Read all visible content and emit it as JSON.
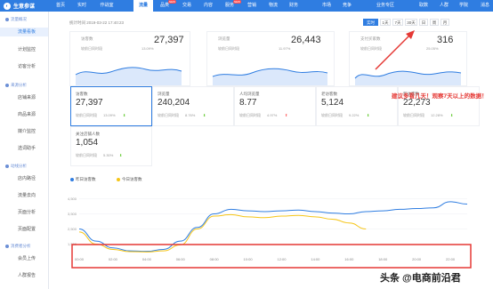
{
  "brand": {
    "name": "生意参谋"
  },
  "nav": {
    "items": [
      {
        "label": "首页"
      },
      {
        "label": "实时"
      },
      {
        "label": "作战室"
      },
      {
        "label": "流量",
        "active": true
      },
      {
        "label": "品类",
        "badge": "NEW"
      },
      {
        "label": "交易"
      },
      {
        "label": "内容"
      },
      {
        "label": "服务",
        "badge": "NEW"
      },
      {
        "label": "营销"
      },
      {
        "label": "物流"
      },
      {
        "label": "财务"
      },
      {
        "label": "市场"
      },
      {
        "label": "竞争"
      },
      {
        "label": "业务专区"
      },
      {
        "label": "取数"
      },
      {
        "label": "人群"
      },
      {
        "label": "学院"
      }
    ],
    "user": "消息"
  },
  "sidebar": {
    "groups": [
      {
        "title": "流量概况",
        "items": [
          {
            "label": "流量看板",
            "active": true
          },
          {
            "label": "计划监控"
          },
          {
            "label": "访客分析"
          }
        ]
      },
      {
        "title": "来源分析",
        "items": [
          {
            "label": "店铺来源"
          },
          {
            "label": "商品来源"
          },
          {
            "label": "媒介监控"
          },
          {
            "label": "选词助手"
          }
        ]
      },
      {
        "title": "动线分析",
        "items": [
          {
            "label": "店内路径"
          },
          {
            "label": "流量去向"
          },
          {
            "label": "页面分析"
          },
          {
            "label": "页面配置"
          }
        ]
      },
      {
        "title": "消费者分析",
        "items": [
          {
            "label": "会员上传"
          },
          {
            "label": "人群报告"
          }
        ]
      }
    ]
  },
  "header": {
    "updated": "统计时间 2019-03-22 17:40:23",
    "ranges": [
      {
        "label": "实时",
        "active": true
      },
      {
        "label": "1天"
      },
      {
        "label": "7天"
      },
      {
        "label": "30天"
      },
      {
        "label": "日"
      },
      {
        "label": "周"
      },
      {
        "label": "月"
      }
    ]
  },
  "top_cards": [
    {
      "label": "访客数",
      "value": "27,397",
      "cmp": "较前日同时段",
      "pct": "13.09%"
    },
    {
      "label": "浏览量",
      "value": "26,443",
      "cmp": "较前日同时段",
      "pct": "11.97%"
    },
    {
      "label": "支付买家数",
      "value": "316",
      "cmp": "较前日同时段",
      "pct": "25.05%"
    }
  ],
  "metrics": [
    {
      "label": "访客数",
      "value": "27,397",
      "cmp": "较前日同时段",
      "pct": "13.09%",
      "dir": "down",
      "selected": true
    },
    {
      "label": "浏览量",
      "value": "240,204",
      "cmp": "较前日同时段",
      "pct": "8.76%",
      "dir": "down"
    },
    {
      "label": "人均浏览量",
      "value": "8.77",
      "cmp": "较前日同时段",
      "pct": "4.97%",
      "dir": "up"
    },
    {
      "label": "老访客数",
      "value": "5,124",
      "cmp": "较前日同时段",
      "pct": "9.22%",
      "dir": "down"
    },
    {
      "label": "新访客数",
      "value": "22,273",
      "cmp": "较前日同时段",
      "pct": "12.28%",
      "dir": "down"
    },
    {
      "label": "关注店铺人数",
      "value": "1,054",
      "cmp": "较前日同时段",
      "pct": "5.30%",
      "dir": "down"
    }
  ],
  "colors": {
    "accent": "#2f7de1",
    "up": "#ff4d4f",
    "down": "#52c41a",
    "annotation": "#e53935",
    "series_today": "#f5c518"
  },
  "annotation": "建议多看几天！观察7天以上的数据！",
  "watermark": "头条 @电商前沿君",
  "chart_data": {
    "type": "line",
    "x": [
      "00:00",
      "01:00",
      "02:00",
      "03:00",
      "04:00",
      "05:00",
      "06:00",
      "07:00",
      "08:00",
      "09:00",
      "10:00",
      "11:00",
      "12:00",
      "13:00",
      "14:00",
      "15:00",
      "16:00",
      "17:00",
      "18:00",
      "19:00",
      "20:00",
      "21:00",
      "22:00",
      "23:00"
    ],
    "y_ticks": [
      "1,500",
      "2,500",
      "3,500",
      "4,500"
    ],
    "ylim": [
      1000,
      5000
    ],
    "series": [
      {
        "name": "昨日访客数",
        "color": "#2f7de1",
        "values": [
          2500,
          1700,
          1250,
          1050,
          1020,
          1150,
          1700,
          2600,
          3500,
          3800,
          3700,
          3650,
          3700,
          3750,
          3650,
          3550,
          3500,
          3650,
          3700,
          3800,
          3850,
          3900,
          4300,
          4150
        ]
      },
      {
        "name": "今日访客数",
        "color": "#f5c518",
        "values": [
          2300,
          1500,
          1150,
          1000,
          980,
          1050,
          1450,
          2500,
          3350,
          3450,
          3300,
          3250,
          3350,
          3400,
          3300,
          3150,
          2900,
          2500,
          null,
          null,
          null,
          null,
          null,
          null
        ]
      }
    ]
  }
}
